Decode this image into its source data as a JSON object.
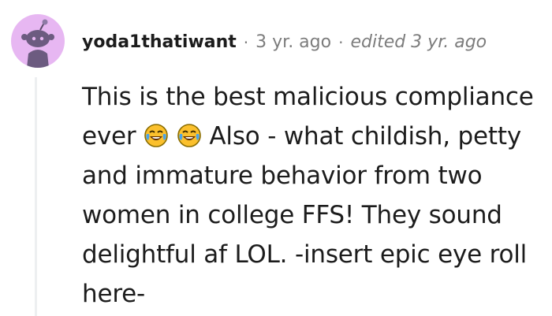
{
  "comment": {
    "username": "yoda1thatiwant",
    "time_ago": "3 yr. ago",
    "edited_label": "edited 3 yr. ago",
    "separator": "·",
    "body": {
      "text_before_emoji": "This is the best malicious compliance ever",
      "emoji_1": "😂",
      "emoji_2": "😂",
      "text_after_emoji": "Also - what childish, petty and immature behavior from two women in college FFS! They sound delightful af LOL. -insert epic eye roll here-"
    },
    "avatar_icon": "snoo-avatar-icon",
    "colors": {
      "avatar_bg": "#e7b7f2",
      "username": "#1c1c1c",
      "meta": "#7c7c7c",
      "thread_line": "#edeff1"
    }
  }
}
